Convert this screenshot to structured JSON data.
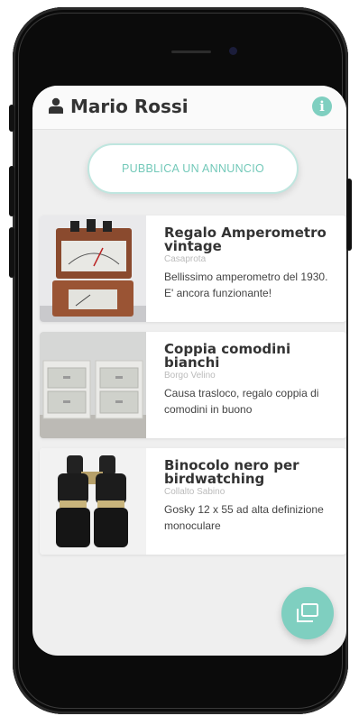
{
  "header": {
    "user_name": "Mario Rossi",
    "user_icon": "user-icon",
    "info_icon": "info-icon",
    "info_glyph": "i",
    "accent_color": "#7fcfc0"
  },
  "publish_button": {
    "label": "PUBBLICA UN ANNUNCIO"
  },
  "listings": [
    {
      "title": "Regalo Amperometro vintage",
      "location": "Casaprota",
      "description": "Bellissimo amperometro del 1930. E' ancora funzionante!"
    },
    {
      "title": "Coppia comodini bianchi",
      "location": "Borgo Velino",
      "description": "Causa trasloco, regalo coppia di comodini in buono"
    },
    {
      "title": "Binocolo nero per birdwatching",
      "location": "Collalto Sabino",
      "description": "Gosky 12 x 55 ad alta definizione monoculare"
    }
  ],
  "fab": {
    "icon": "gallery-icon"
  }
}
